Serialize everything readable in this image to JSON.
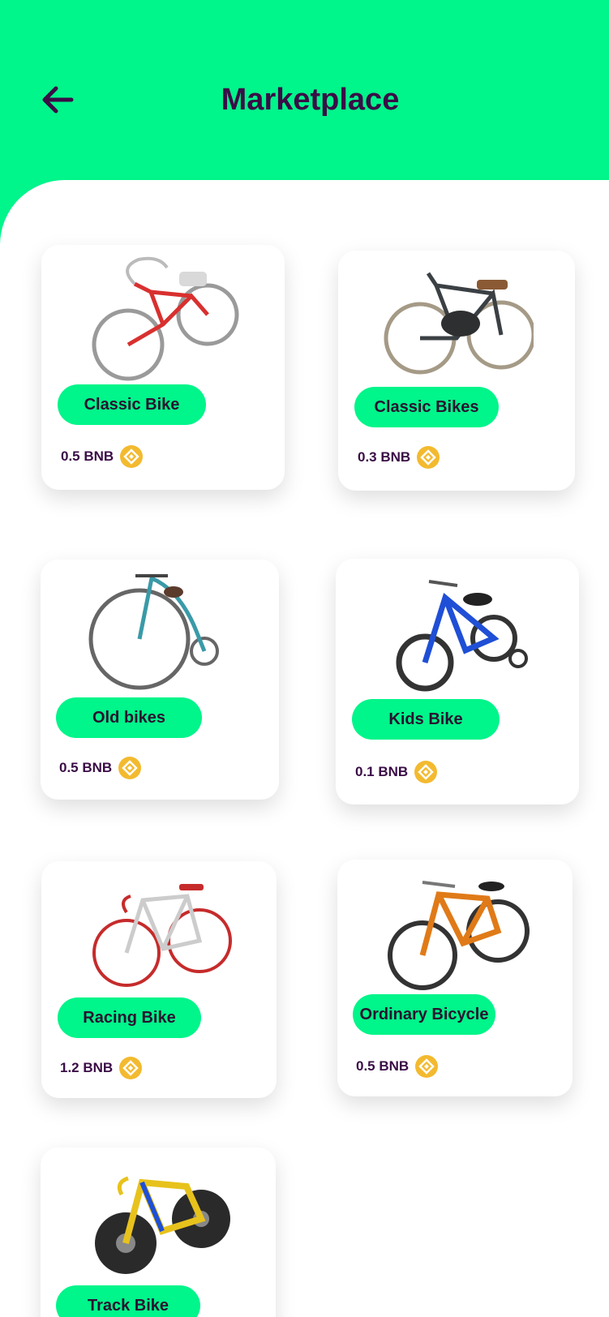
{
  "header": {
    "title": "Marketplace",
    "back_icon": "arrow-left-icon",
    "background": "#00f58a",
    "title_color": "#3a0d46"
  },
  "products": [
    {
      "name": "Classic Bike",
      "price": "0.5 BNB",
      "frame_color": "#d8302f"
    },
    {
      "name": "Classic Bikes",
      "price": "0.3 BNB",
      "frame_color": "#3b4044"
    },
    {
      "name": "Old bikes",
      "price": "0.5 BNB",
      "frame_color": "#3a9aa8"
    },
    {
      "name": "Kids Bike",
      "price": "0.1 BNB",
      "frame_color": "#1f4fd6"
    },
    {
      "name": "Racing Bike",
      "price": "1.2 BNB",
      "frame_color": "#c62b2b"
    },
    {
      "name": "Ordinary Bicycle",
      "price": "0.5 BNB",
      "frame_color": "#e07a18"
    },
    {
      "name": "Track Bike",
      "price": "",
      "frame_color": "#e8c21c"
    }
  ],
  "currency_icon": "bnb-coin-icon",
  "accent_color": "#00f58a",
  "coin_color": "#f3ba2f"
}
